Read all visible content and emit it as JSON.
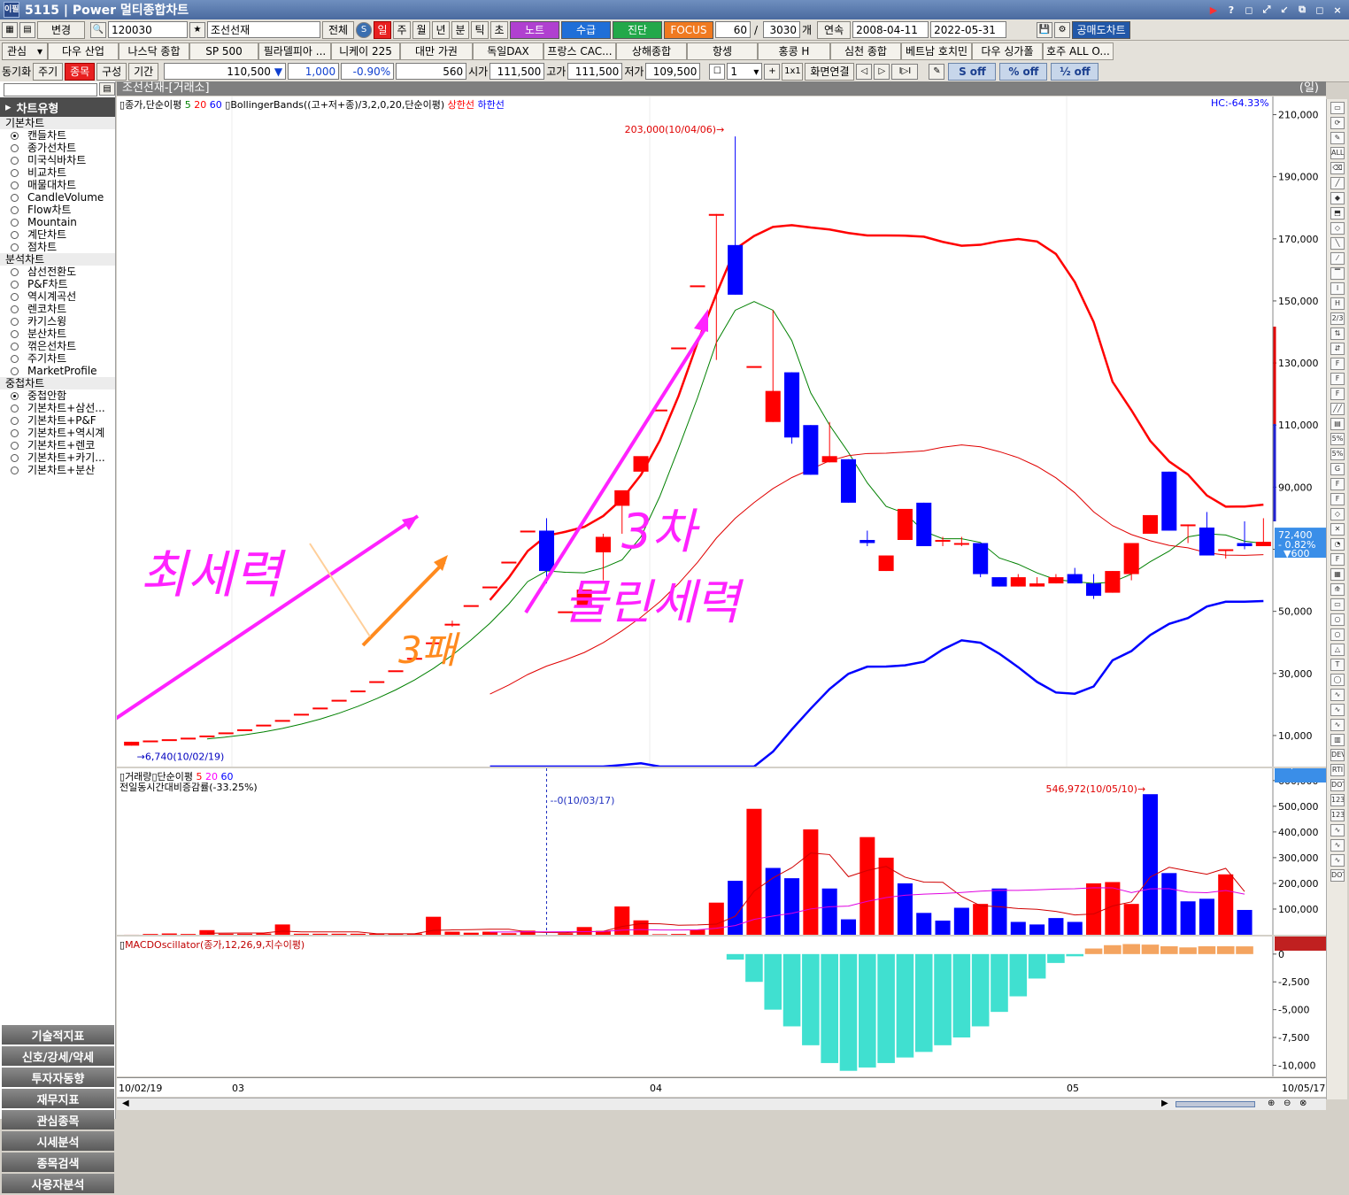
{
  "window": {
    "badge": "이필",
    "title": "5115 | Power 멀티종합차트",
    "controls": [
      "▶",
      "?",
      "◻",
      "⤢",
      "↙",
      "⧉",
      "◻",
      "×"
    ]
  },
  "toolbar1": {
    "change_label": "변경",
    "code": "120030",
    "name": "조선선재",
    "all_label": "전체",
    "periods": [
      "일",
      "주",
      "월",
      "년",
      "분",
      "틱",
      "초"
    ],
    "active_period": "일",
    "note_label": "노트",
    "supply_label": "수급",
    "diag_label": "진단",
    "focus_label": "FOCUS",
    "count": "60",
    "total": "3030",
    "count_unit": "개",
    "continuous_label": "연속",
    "date_from": "2008-04-11",
    "date_to": "2022-05-31",
    "short_chart_label": "공매도차트"
  },
  "toolbar2": {
    "watch_label": "관심",
    "markets": [
      "다우 산업",
      "나스닥 종합",
      "SP 500",
      "필라델피아 ...",
      "니케이 225",
      "대만 가권",
      "독일DAX",
      "프랑스 CAC...",
      "상해종합",
      "항셍",
      "홍콩 H",
      "심천 종합",
      "베트남 호치민",
      "다우 싱가폴",
      "호주 ALL O..."
    ]
  },
  "toolbar3": {
    "sync_label": "동기화",
    "week_label": "주기",
    "item_label": "종목",
    "config_label": "구성",
    "period_label": "기간",
    "price": "110,500",
    "change_arrow": "▼",
    "change": "1,000",
    "change_pct": "-0.90%",
    "volume": "560",
    "open_label": "시가",
    "open": "111,500",
    "high_label": "고가",
    "high": "111,500",
    "low_label": "저가",
    "low": "109,500",
    "spin": "1",
    "ratio_label": "1x1",
    "link_label": "화면연결",
    "off1": "off",
    "off2": "off",
    "off3": "off"
  },
  "sidebar": {
    "header": "차트유형",
    "sections": [
      {
        "title": "기본차트",
        "items": [
          {
            "label": "캔들차트",
            "on": true
          },
          {
            "label": "종가선차트"
          },
          {
            "label": "미국식바차트"
          },
          {
            "label": "비교차트"
          },
          {
            "label": "매물대차트"
          },
          {
            "label": "CandleVolume"
          },
          {
            "label": "Flow차트"
          },
          {
            "label": "Mountain"
          },
          {
            "label": "계단차트"
          },
          {
            "label": "점차트"
          }
        ]
      },
      {
        "title": "분석차트",
        "items": [
          {
            "label": "삼선전환도"
          },
          {
            "label": "P&F차트"
          },
          {
            "label": "역시계곡선"
          },
          {
            "label": "렌코차트"
          },
          {
            "label": "카기스윙"
          },
          {
            "label": "분산차트"
          },
          {
            "label": "꺾은선차트"
          },
          {
            "label": "주기차트"
          },
          {
            "label": "MarketProfile"
          }
        ]
      },
      {
        "title": "중첩차트",
        "items": [
          {
            "label": "중첩안함",
            "on": true
          },
          {
            "label": "기본차트+삼선..."
          },
          {
            "label": "기본차트+P&F"
          },
          {
            "label": "기본차트+역시계"
          },
          {
            "label": "기본차트+렌코"
          },
          {
            "label": "기본차트+카기..."
          },
          {
            "label": "기본차트+분산"
          }
        ]
      }
    ],
    "bottom_menu": [
      "기술적지표",
      "신호/강세/약세",
      "투자자동향",
      "재무지표",
      "관심종목",
      "시세분석",
      "종목검색",
      "사용자분석"
    ]
  },
  "chart": {
    "title": "조선선재-[거래소]",
    "period_tag": "(일)",
    "price_legend": "종가,단순이평",
    "ma_periods": [
      "5",
      "20",
      "60"
    ],
    "bb_legend": "BollingerBands((고+저+종)/3,2,0,20,단순이평)",
    "bb_upper": "상한선",
    "bb_lower": "하한선",
    "hc": "HC:-64.33%",
    "max_label": "203,000(10/04/06)",
    "min_label": "6,740(10/02/19)",
    "last_price": "72,400",
    "last_change": "- 0.82%",
    "last_sub": "▼600",
    "volume_legend": "거래량",
    "volume_ma": "단순이평",
    "volume_sub": "전일동시간대비증감률(-33.25%)",
    "volume_max_label": "546,972(10/05/10)",
    "volume_marker": "0(10/03/17)",
    "volume_last": "96,548",
    "macd_legend": "MACDOscillator(종가,12,26,9,지수이평)",
    "macd_last": "692.25",
    "date_start": "10/02/19",
    "date_end": "10/05/17",
    "month_labels": [
      "03",
      "04",
      "05"
    ],
    "annotations": {
      "a1": "최세력",
      "a2": "3차",
      "a3": "물린세력",
      "a4": "3패"
    },
    "colors": {
      "up": "#ff0000",
      "down": "#0000ff",
      "magenta": "#ff22ff",
      "orange": "#ff8a1e",
      "macd": "#40e0d0",
      "macd_pos": "#f4a460"
    }
  },
  "chart_data": [
    {
      "type": "candlestick",
      "title": "조선선재-[거래소]",
      "y_ticks": [
        10000,
        30000,
        50000,
        70000,
        90000,
        110000,
        130000,
        150000,
        170000,
        190000,
        210000
      ],
      "ylim": [
        0,
        213000
      ],
      "candles": [
        [
          6740,
          8000,
          6740,
          8000
        ],
        [
          8400,
          8400,
          8400,
          8400
        ],
        [
          8800,
          8800,
          8800,
          8800
        ],
        [
          9300,
          9300,
          9300,
          9300
        ],
        [
          10000,
          10000,
          10000,
          10000
        ],
        [
          11000,
          11000,
          11000,
          11000
        ],
        [
          12000,
          12000,
          12000,
          12000
        ],
        [
          13500,
          13500,
          13500,
          13500
        ],
        [
          15000,
          15000,
          15000,
          15000
        ],
        [
          17000,
          17000,
          17000,
          17000
        ],
        [
          19000,
          19000,
          19000,
          19000
        ],
        [
          21500,
          21500,
          21500,
          21500
        ],
        [
          24500,
          24500,
          24500,
          24500
        ],
        [
          27500,
          27500,
          27500,
          27500
        ],
        [
          31000,
          31000,
          31000,
          31000
        ],
        [
          35000,
          35000,
          35000,
          35000
        ],
        [
          40000,
          40000,
          40000,
          40000
        ],
        [
          46000,
          47000,
          45000,
          46000
        ],
        [
          52000,
          52000,
          52000,
          52000
        ],
        [
          58000,
          58000,
          58000,
          58000
        ],
        [
          66000,
          66000,
          66000,
          66000
        ],
        [
          76000,
          76000,
          76000,
          76000
        ],
        [
          76000,
          80000,
          59000,
          63000
        ],
        [
          50000,
          50000,
          50000,
          50000
        ],
        [
          52000,
          57000,
          52000,
          57000
        ],
        [
          69000,
          75000,
          60000,
          74000
        ],
        [
          84000,
          84000,
          75000,
          89000
        ],
        [
          95000,
          95000,
          95000,
          100000
        ],
        [
          115000,
          115000,
          115000,
          115000
        ],
        [
          135000,
          135000,
          135000,
          135000
        ],
        [
          155000,
          155000,
          155000,
          155000
        ],
        [
          178000,
          178000,
          131000,
          178000
        ],
        [
          168000,
          203000,
          152000,
          152000
        ],
        [
          129000,
          129000,
          129000,
          129000
        ],
        [
          111000,
          147000,
          111000,
          121000
        ],
        [
          127000,
          127000,
          104000,
          106000
        ],
        [
          110000,
          110000,
          94000,
          94000
        ],
        [
          98000,
          111000,
          98000,
          100000
        ],
        [
          99000,
          99000,
          85000,
          85000
        ],
        [
          73000,
          76000,
          71000,
          72000
        ],
        [
          63000,
          68000,
          63000,
          68000
        ],
        [
          73000,
          82000,
          73000,
          83000
        ],
        [
          85000,
          85000,
          71000,
          71000
        ],
        [
          73000,
          74000,
          71000,
          73000
        ],
        [
          72000,
          74000,
          71000,
          72000
        ],
        [
          72000,
          72000,
          61000,
          62000
        ],
        [
          61000,
          61000,
          58000,
          58000
        ],
        [
          58000,
          62000,
          58000,
          61000
        ],
        [
          58000,
          61000,
          58000,
          59000
        ],
        [
          59000,
          62000,
          59000,
          61000
        ],
        [
          62000,
          64000,
          59000,
          59000
        ],
        [
          59000,
          62000,
          54000,
          55000
        ],
        [
          56000,
          63000,
          56000,
          63000
        ],
        [
          62000,
          70000,
          60000,
          72000
        ],
        [
          75000,
          81000,
          75000,
          81000
        ],
        [
          95000,
          95000,
          76000,
          76000
        ],
        [
          78000,
          78000,
          72000,
          78000
        ],
        [
          77000,
          82000,
          68000,
          68000
        ],
        [
          70000,
          70000,
          67000,
          70000
        ],
        [
          72000,
          79000,
          70000,
          71000
        ],
        [
          71000,
          80000,
          71000,
          72400
        ]
      ],
      "ma5": [],
      "bollinger": {
        "period": 20,
        "stdev": 2
      }
    },
    {
      "type": "bar",
      "title": "거래량",
      "y_ticks": [
        100000,
        200000,
        300000,
        400000,
        500000,
        600000
      ],
      "ylim": [
        0,
        620000
      ],
      "values": [
        200,
        3000,
        5000,
        3000,
        18000,
        4000,
        4000,
        5000,
        40000,
        4000,
        4000,
        4000,
        4000,
        4000,
        3000,
        5000,
        70000,
        12000,
        8000,
        12000,
        6000,
        16000,
        0,
        6000,
        30000,
        15000,
        110000,
        56000,
        2000,
        3000,
        20000,
        125000,
        210000,
        490000,
        260000,
        220000,
        410000,
        180000,
        60000,
        380000,
        300000,
        200000,
        85000,
        55000,
        105000,
        120000,
        180000,
        50000,
        40000,
        65000,
        50000,
        200000,
        205000,
        120000,
        546972,
        240000,
        130000,
        140000,
        235000,
        96548
      ],
      "up_flags": [
        1,
        1,
        1,
        1,
        1,
        1,
        1,
        1,
        1,
        1,
        1,
        1,
        1,
        1,
        1,
        1,
        1,
        1,
        1,
        1,
        1,
        1,
        0,
        1,
        1,
        1,
        1,
        1,
        1,
        1,
        1,
        1,
        0,
        1,
        0,
        0,
        1,
        0,
        0,
        1,
        1,
        0,
        0,
        0,
        0,
        1,
        0,
        0,
        0,
        0,
        0,
        1,
        1,
        1,
        0,
        0,
        0,
        0,
        1,
        0
      ]
    },
    {
      "type": "bar",
      "title": "MACDOscillator(종가,12,26,9,지수이평)",
      "y_ticks": [
        0,
        -2500,
        -5000,
        -7500,
        -10000
      ],
      "ylim": [
        -11000,
        1100
      ],
      "values": [
        0,
        0,
        0,
        0,
        0,
        0,
        0,
        0,
        0,
        0,
        0,
        0,
        0,
        0,
        0,
        0,
        0,
        0,
        0,
        0,
        0,
        0,
        0,
        0,
        0,
        0,
        0,
        0,
        0,
        0,
        0,
        0,
        -500,
        -2500,
        -5000,
        -6500,
        -8200,
        -9800,
        -10500,
        -10200,
        -9800,
        -9300,
        -8800,
        -8200,
        -7500,
        -6500,
        -5200,
        -3800,
        -2200,
        -800,
        -200,
        500,
        800,
        900,
        850,
        700,
        600,
        700,
        700,
        692.25
      ]
    }
  ]
}
